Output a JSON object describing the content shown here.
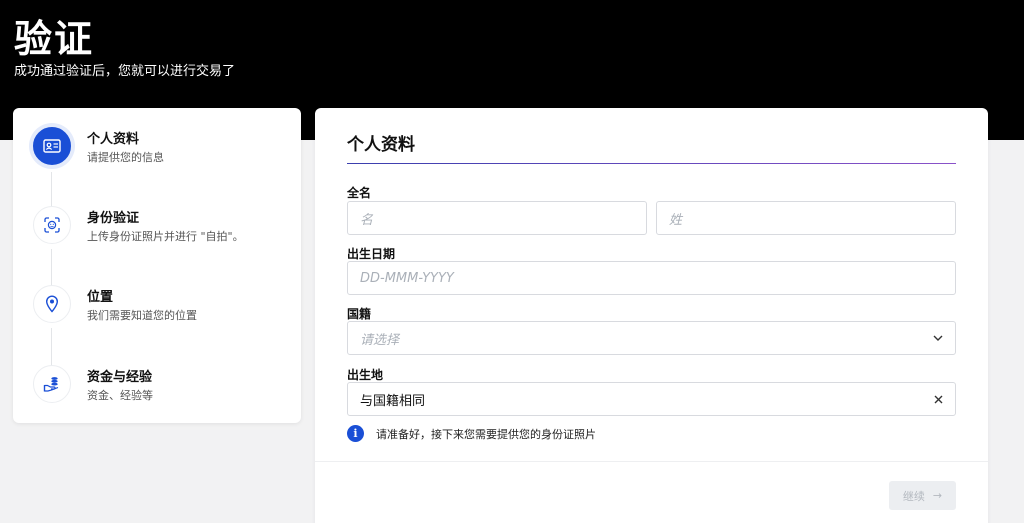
{
  "header": {
    "title": "验证",
    "subtitle": "成功通过验证后，您就可以进行交易了"
  },
  "steps": [
    {
      "title": "个人资料",
      "subtitle": "请提供您的信息",
      "icon": "id-card-icon",
      "active": true
    },
    {
      "title": "身份验证",
      "subtitle": "上传身份证照片并进行 \"自拍\"。",
      "icon": "face-scan-icon",
      "active": false
    },
    {
      "title": "位置",
      "subtitle": "我们需要知道您的位置",
      "icon": "map-pin-icon",
      "active": false
    },
    {
      "title": "资金与经验",
      "subtitle": "资金、经验等",
      "icon": "coins-icon",
      "active": false
    }
  ],
  "form": {
    "title": "个人资料",
    "full_name_label": "全名",
    "first_name_placeholder": "名",
    "last_name_placeholder": "姓",
    "dob_label": "出生日期",
    "dob_placeholder": "DD-MMM-YYYY",
    "nationality_label": "国籍",
    "nationality_placeholder": "请选择",
    "birthplace_label": "出生地",
    "birthplace_value": "与国籍相同",
    "note": "请准备好，接下来您需要提供您的身份证照片",
    "info_glyph": "i",
    "continue_label": "继续",
    "continue_arrow": "→"
  },
  "colors": {
    "accent": "#1a4fd6",
    "hero_bg": "#000000",
    "page_bg": "#f2f2f3"
  }
}
